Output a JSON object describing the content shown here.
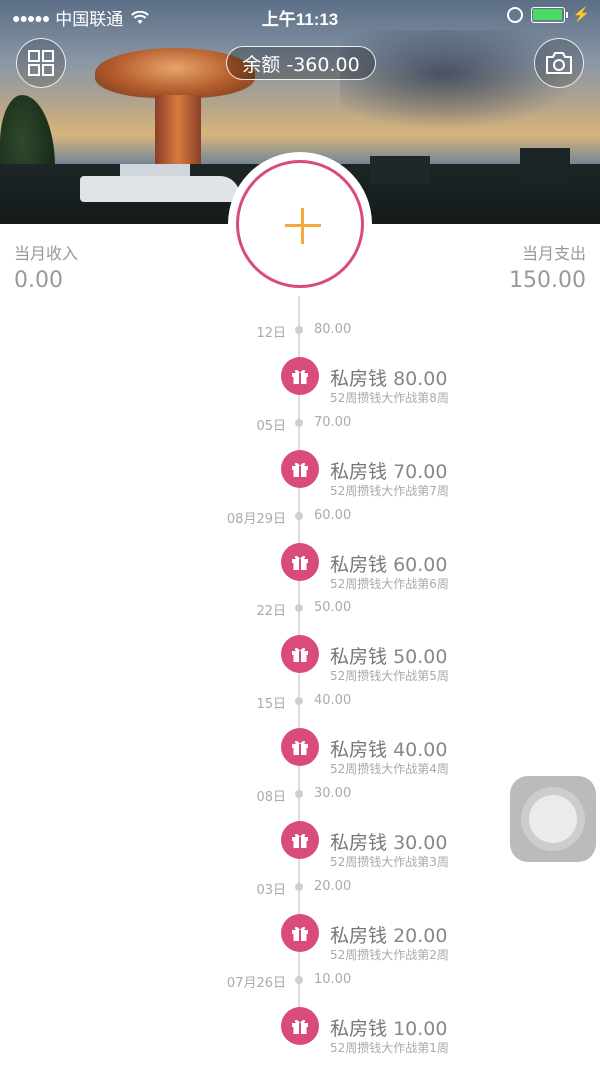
{
  "status_bar": {
    "signal": "●●●●●",
    "carrier": "中国联通",
    "time": "上午11:13"
  },
  "header": {
    "balance_label": "余额 -360.00",
    "grid_icon": "grid-icon",
    "camera_icon": "camera-icon"
  },
  "summary": {
    "income_label": "当月收入",
    "income_value": "0.00",
    "expense_label": "当月支出",
    "expense_value": "150.00"
  },
  "colors": {
    "accent": "#d94b78",
    "plus": "#f2a93b",
    "battery": "#4cd964"
  },
  "timeline": [
    {
      "date": "12日",
      "sum": "80.00",
      "title": "私房钱",
      "amount": "80.00",
      "note": "52周攒钱大作战第8周"
    },
    {
      "date": "05日",
      "sum": "70.00",
      "title": "私房钱",
      "amount": "70.00",
      "note": "52周攒钱大作战第7周"
    },
    {
      "date": "08月29日",
      "sum": "60.00",
      "title": "私房钱",
      "amount": "60.00",
      "note": "52周攒钱大作战第6周"
    },
    {
      "date": "22日",
      "sum": "50.00",
      "title": "私房钱",
      "amount": "50.00",
      "note": "52周攒钱大作战第5周"
    },
    {
      "date": "15日",
      "sum": "40.00",
      "title": "私房钱",
      "amount": "40.00",
      "note": "52周攒钱大作战第4周"
    },
    {
      "date": "08日",
      "sum": "30.00",
      "title": "私房钱",
      "amount": "30.00",
      "note": "52周攒钱大作战第3周"
    },
    {
      "date": "03日",
      "sum": "20.00",
      "title": "私房钱",
      "amount": "20.00",
      "note": "52周攒钱大作战第2周"
    },
    {
      "date": "07月26日",
      "sum": "10.00",
      "title": "私房钱",
      "amount": "10.00",
      "note": "52周攒钱大作战第1周"
    }
  ]
}
